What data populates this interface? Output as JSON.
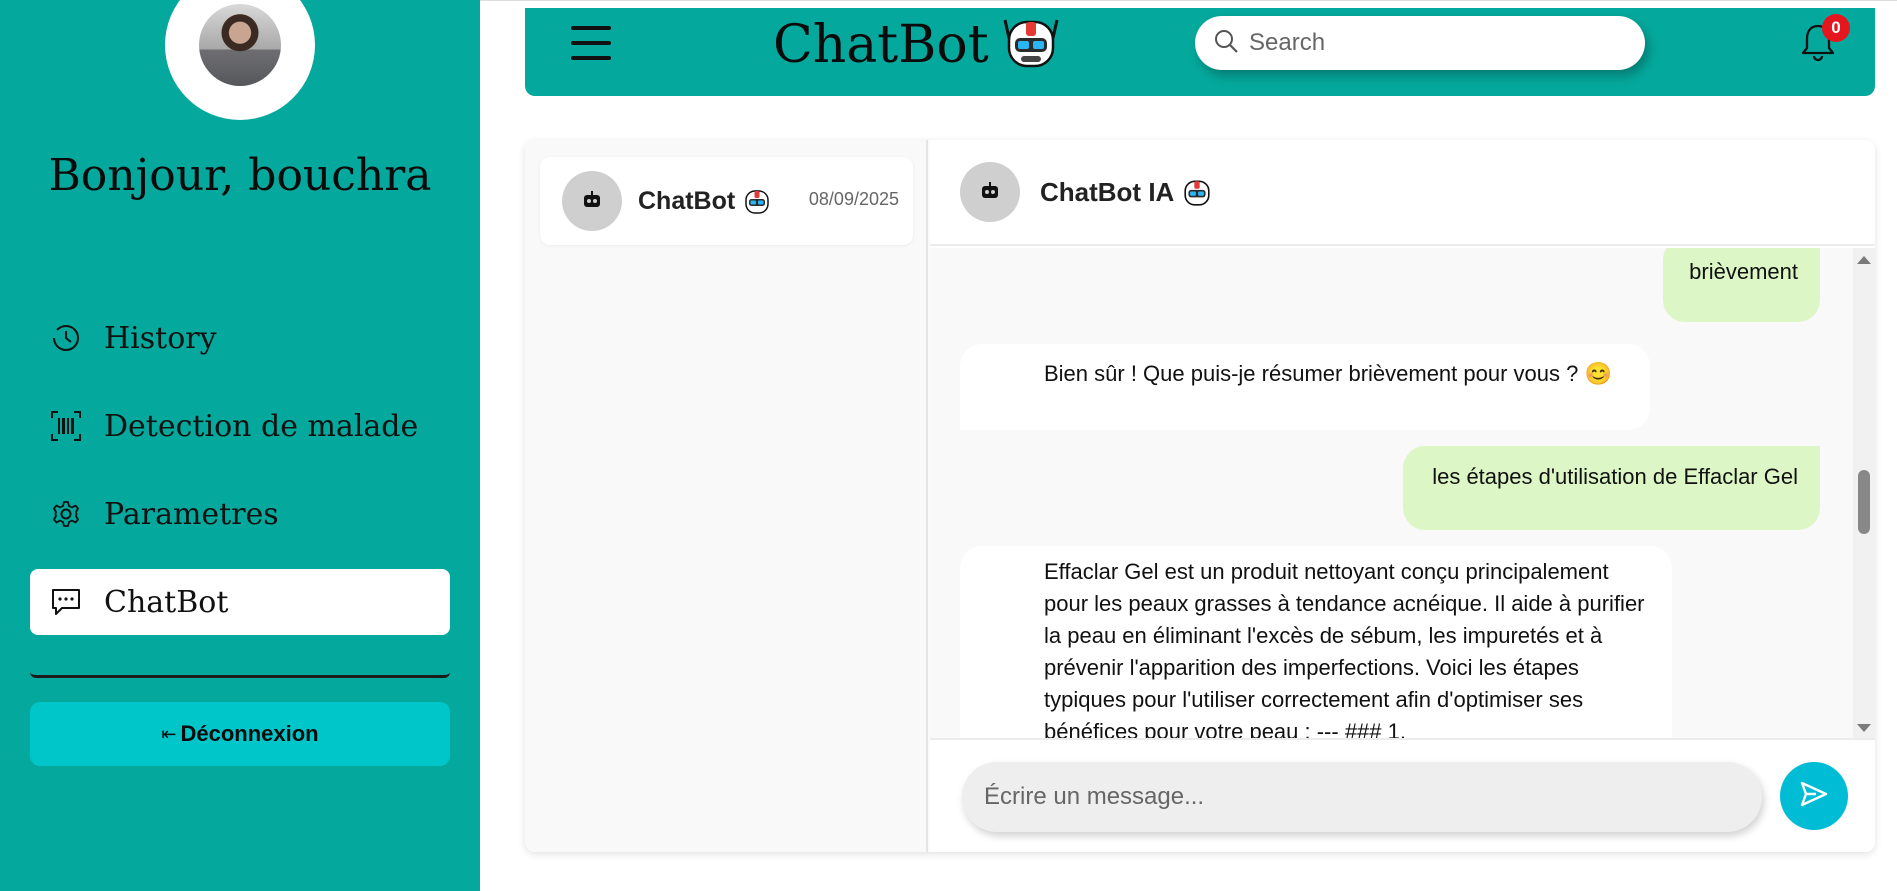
{
  "sidebar": {
    "greeting": "Bonjour, bouchra",
    "nav": [
      {
        "label": "History",
        "icon": "clock-icon"
      },
      {
        "label": "Detection de malade",
        "icon": "barcode-scan-icon"
      },
      {
        "label": "Parametres",
        "icon": "gear-icon"
      },
      {
        "label": "ChatBot",
        "icon": "chat-bubble-icon",
        "active": true
      }
    ],
    "logout_label": "Déconnexion"
  },
  "topbar": {
    "brand": "ChatBot",
    "search_placeholder": "Search",
    "notification_count": "0"
  },
  "conversations": [
    {
      "name": "ChatBot",
      "date": "08/09/2025"
    }
  ],
  "chat": {
    "header_name": "ChatBot IA",
    "messages": [
      {
        "role": "user",
        "text": "brièvement"
      },
      {
        "role": "bot",
        "text": "Bien sûr ! Que puis-je résumer brièvement pour vous ? 😊"
      },
      {
        "role": "user",
        "text": "les étapes d'utilisation de Effaclar Gel"
      },
      {
        "role": "bot",
        "text": "Effaclar Gel est un produit nettoyant conçu principalement pour les peaux grasses à tendance acnéique. Il aide à purifier la peau en éliminant l'excès de sébum, les impuretés et à prévenir l'apparition des imperfections. Voici les étapes typiques pour l'utiliser correctement afin d'optimiser ses bénéfices pour votre peau : --- ### 1."
      }
    ],
    "composer_placeholder": "Écrire un message..."
  },
  "colors": {
    "primary_teal": "#05a89c",
    "logout_cyan": "#00c5c9",
    "user_bubble": "#dcf7c5",
    "send_button": "#00bcd4",
    "badge_red": "#e5161e"
  }
}
